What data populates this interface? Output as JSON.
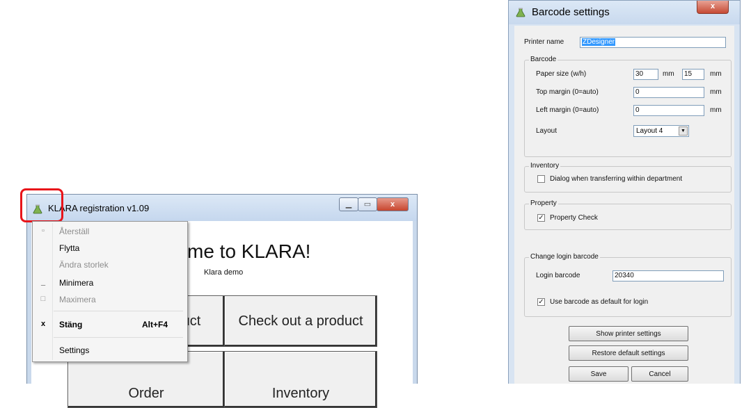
{
  "klara": {
    "title": "KLARA registration v1.09",
    "welcome": "me to KLARA!",
    "subtitle": "Klara demo",
    "buttons": {
      "register": "uct",
      "checkout": "Check out a product",
      "order": "Order",
      "inventory": "Inventory"
    },
    "window_controls": {
      "close": "x"
    }
  },
  "system_menu": {
    "items": [
      {
        "label": "Återställ",
        "icon": "restore-icon",
        "disabled": true
      },
      {
        "label": "Flytta",
        "disabled": false
      },
      {
        "label": "Ändra storlek",
        "disabled": true
      },
      {
        "label": "Minimera",
        "icon": "minimize-icon",
        "icon_glyph": "_",
        "disabled": false
      },
      {
        "label": "Maximera",
        "icon": "maximize-icon",
        "icon_glyph": "□",
        "disabled": true
      },
      {
        "label": "Stäng",
        "icon": "close-icon",
        "icon_glyph": "x",
        "accel": "Alt+F4",
        "bold": true
      },
      {
        "label": "Settings",
        "disabled": false
      }
    ]
  },
  "barcode_settings": {
    "title": "Barcode settings",
    "close_glyph": "x",
    "printer_name_label": "Printer name",
    "printer_name_value": "ZDesigner",
    "barcode_group": {
      "label": "Barcode",
      "paper_size_label": "Paper size (w/h)",
      "paper_width": "30",
      "paper_height": "15",
      "unit": "mm",
      "top_margin_label": "Top margin (0=auto)",
      "top_margin": "0",
      "left_margin_label": "Left margin (0=auto)",
      "left_margin": "0",
      "layout_label": "Layout",
      "layout_value": "Layout 4"
    },
    "inventory_group": {
      "label": "Inventory",
      "dialog_label": "Dialog when transferring within department",
      "dialog_checked": false
    },
    "property_group": {
      "label": "Property",
      "property_check_label": "Property Check",
      "property_check_checked": true
    },
    "login_group": {
      "label": "Change login barcode",
      "login_barcode_label": "Login barcode",
      "login_barcode_value": "20340",
      "use_default_label": "Use barcode as default for login",
      "use_default_checked": true
    },
    "buttons": {
      "show_printer": "Show printer settings",
      "restore": "Restore default settings",
      "save": "Save",
      "cancel": "Cancel"
    }
  },
  "colors": {
    "highlight": "#e8141a",
    "selection": "#3399ff"
  }
}
